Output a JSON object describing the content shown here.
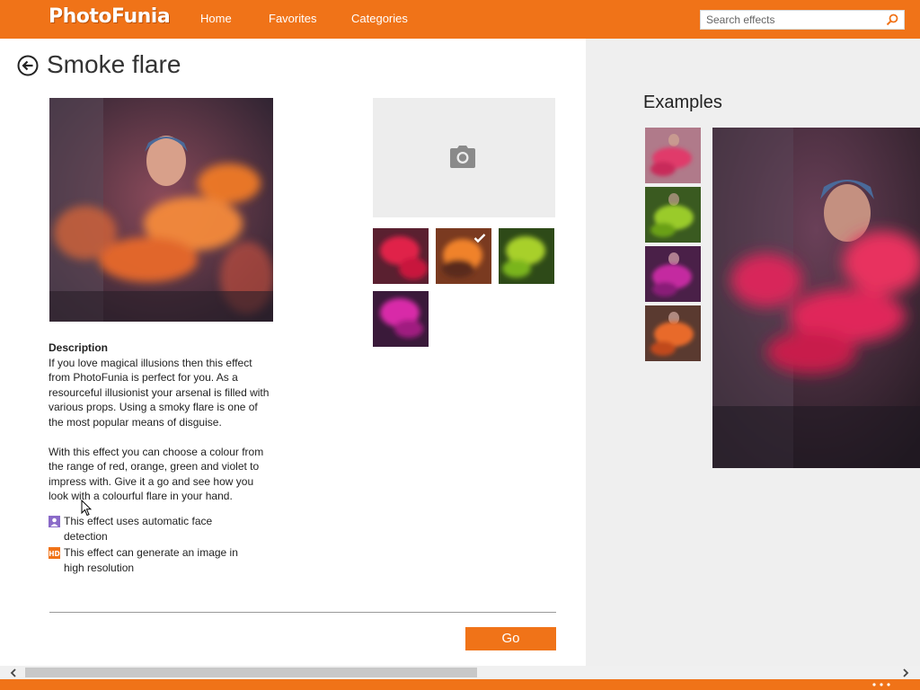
{
  "header": {
    "logo": "PhotoFunia",
    "nav": [
      "Home",
      "Favorites",
      "Categories"
    ],
    "search_placeholder": "Search effects"
  },
  "page": {
    "title": "Smoke flare"
  },
  "effect": {
    "colors": [
      {
        "name": "red",
        "hex": "#d11a3d",
        "selected": false
      },
      {
        "name": "orange",
        "hex": "#f07318",
        "selected": true
      },
      {
        "name": "green",
        "hex": "#8dc61a",
        "selected": false
      },
      {
        "name": "violet",
        "hex": "#c01a9a",
        "selected": false
      }
    ]
  },
  "description": {
    "heading": "Description",
    "para1": "If you love magical illusions then this effect from PhotoFunia is perfect for you. As a resourceful illusionist your arsenal is filled with various props. Using a smoky flare is one of the most popular means of disguise.",
    "para2": "With this effect you can choose a colour from the range of red, orange, green and violet to impress with. Give it a go and see how you look with a colourful flare in your hand."
  },
  "features": {
    "face": "This effect uses automatic face detection",
    "hd": "This effect can generate an image in high resolution",
    "hd_badge": "HD"
  },
  "actions": {
    "go": "Go"
  },
  "examples": {
    "title": "Examples",
    "thumb_colors": [
      "#d63a6a",
      "#7ab51d",
      "#b01c8c",
      "#e0651f"
    ]
  },
  "colors": {
    "accent": "#f07318",
    "panel_bg": "#efefef",
    "upload_bg": "#ededed"
  }
}
